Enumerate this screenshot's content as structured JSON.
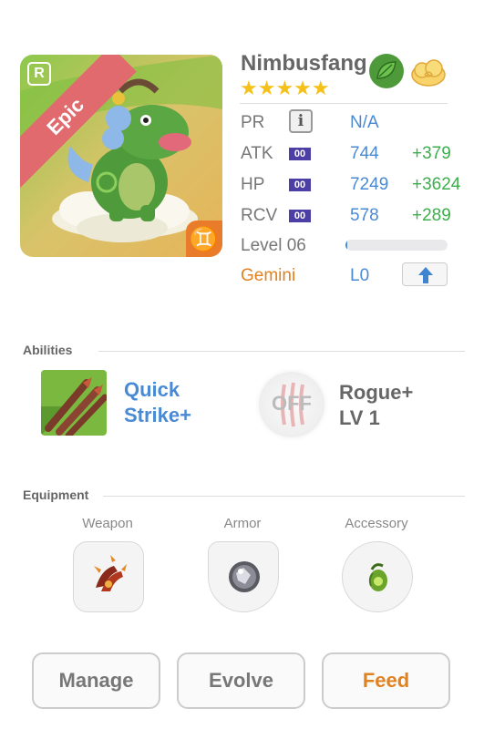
{
  "monster": {
    "name": "Nimbusfang",
    "stars": "★★★★★",
    "rarity": "Epic",
    "rarity_badge": "R",
    "zodiac_symbol": "♊",
    "element_icon": "leaf-icon",
    "skill_type_icon": "cloud-icon"
  },
  "stats": {
    "pr": {
      "label": "PR",
      "value": "N/A",
      "info_icon": "i"
    },
    "atk": {
      "label": "ATK",
      "tag": "00",
      "value": "744",
      "bonus": "+379"
    },
    "hp": {
      "label": "HP",
      "tag": "00",
      "value": "7249",
      "bonus": "+3624"
    },
    "rcv": {
      "label": "RCV",
      "tag": "00",
      "value": "578",
      "bonus": "+289"
    },
    "level": {
      "label": "Level 06",
      "progress": 0.02
    },
    "zodiac": {
      "label": "Gemini",
      "level": "L0"
    }
  },
  "abilities": {
    "title": "Abilities",
    "active": {
      "name_line1": "Quick",
      "name_line2": "Strike+"
    },
    "passive": {
      "toggle": "OFF",
      "name_line1": "Rogue+",
      "name_line2": "LV 1"
    }
  },
  "equipment": {
    "title": "Equipment",
    "slots": [
      {
        "label": "Weapon",
        "icon": "claw-icon"
      },
      {
        "label": "Armor",
        "icon": "orb-icon"
      },
      {
        "label": "Accessory",
        "icon": "gem-icon"
      }
    ]
  },
  "actions": {
    "manage": "Manage",
    "evolve": "Evolve",
    "feed": "Feed"
  },
  "colors": {
    "accent_blue": "#4a8ad4",
    "bonus_green": "#3cae4c",
    "zodiac_orange": "#e0821f",
    "epic_banner": "#e06a6e",
    "star_gold": "#f5c119"
  }
}
